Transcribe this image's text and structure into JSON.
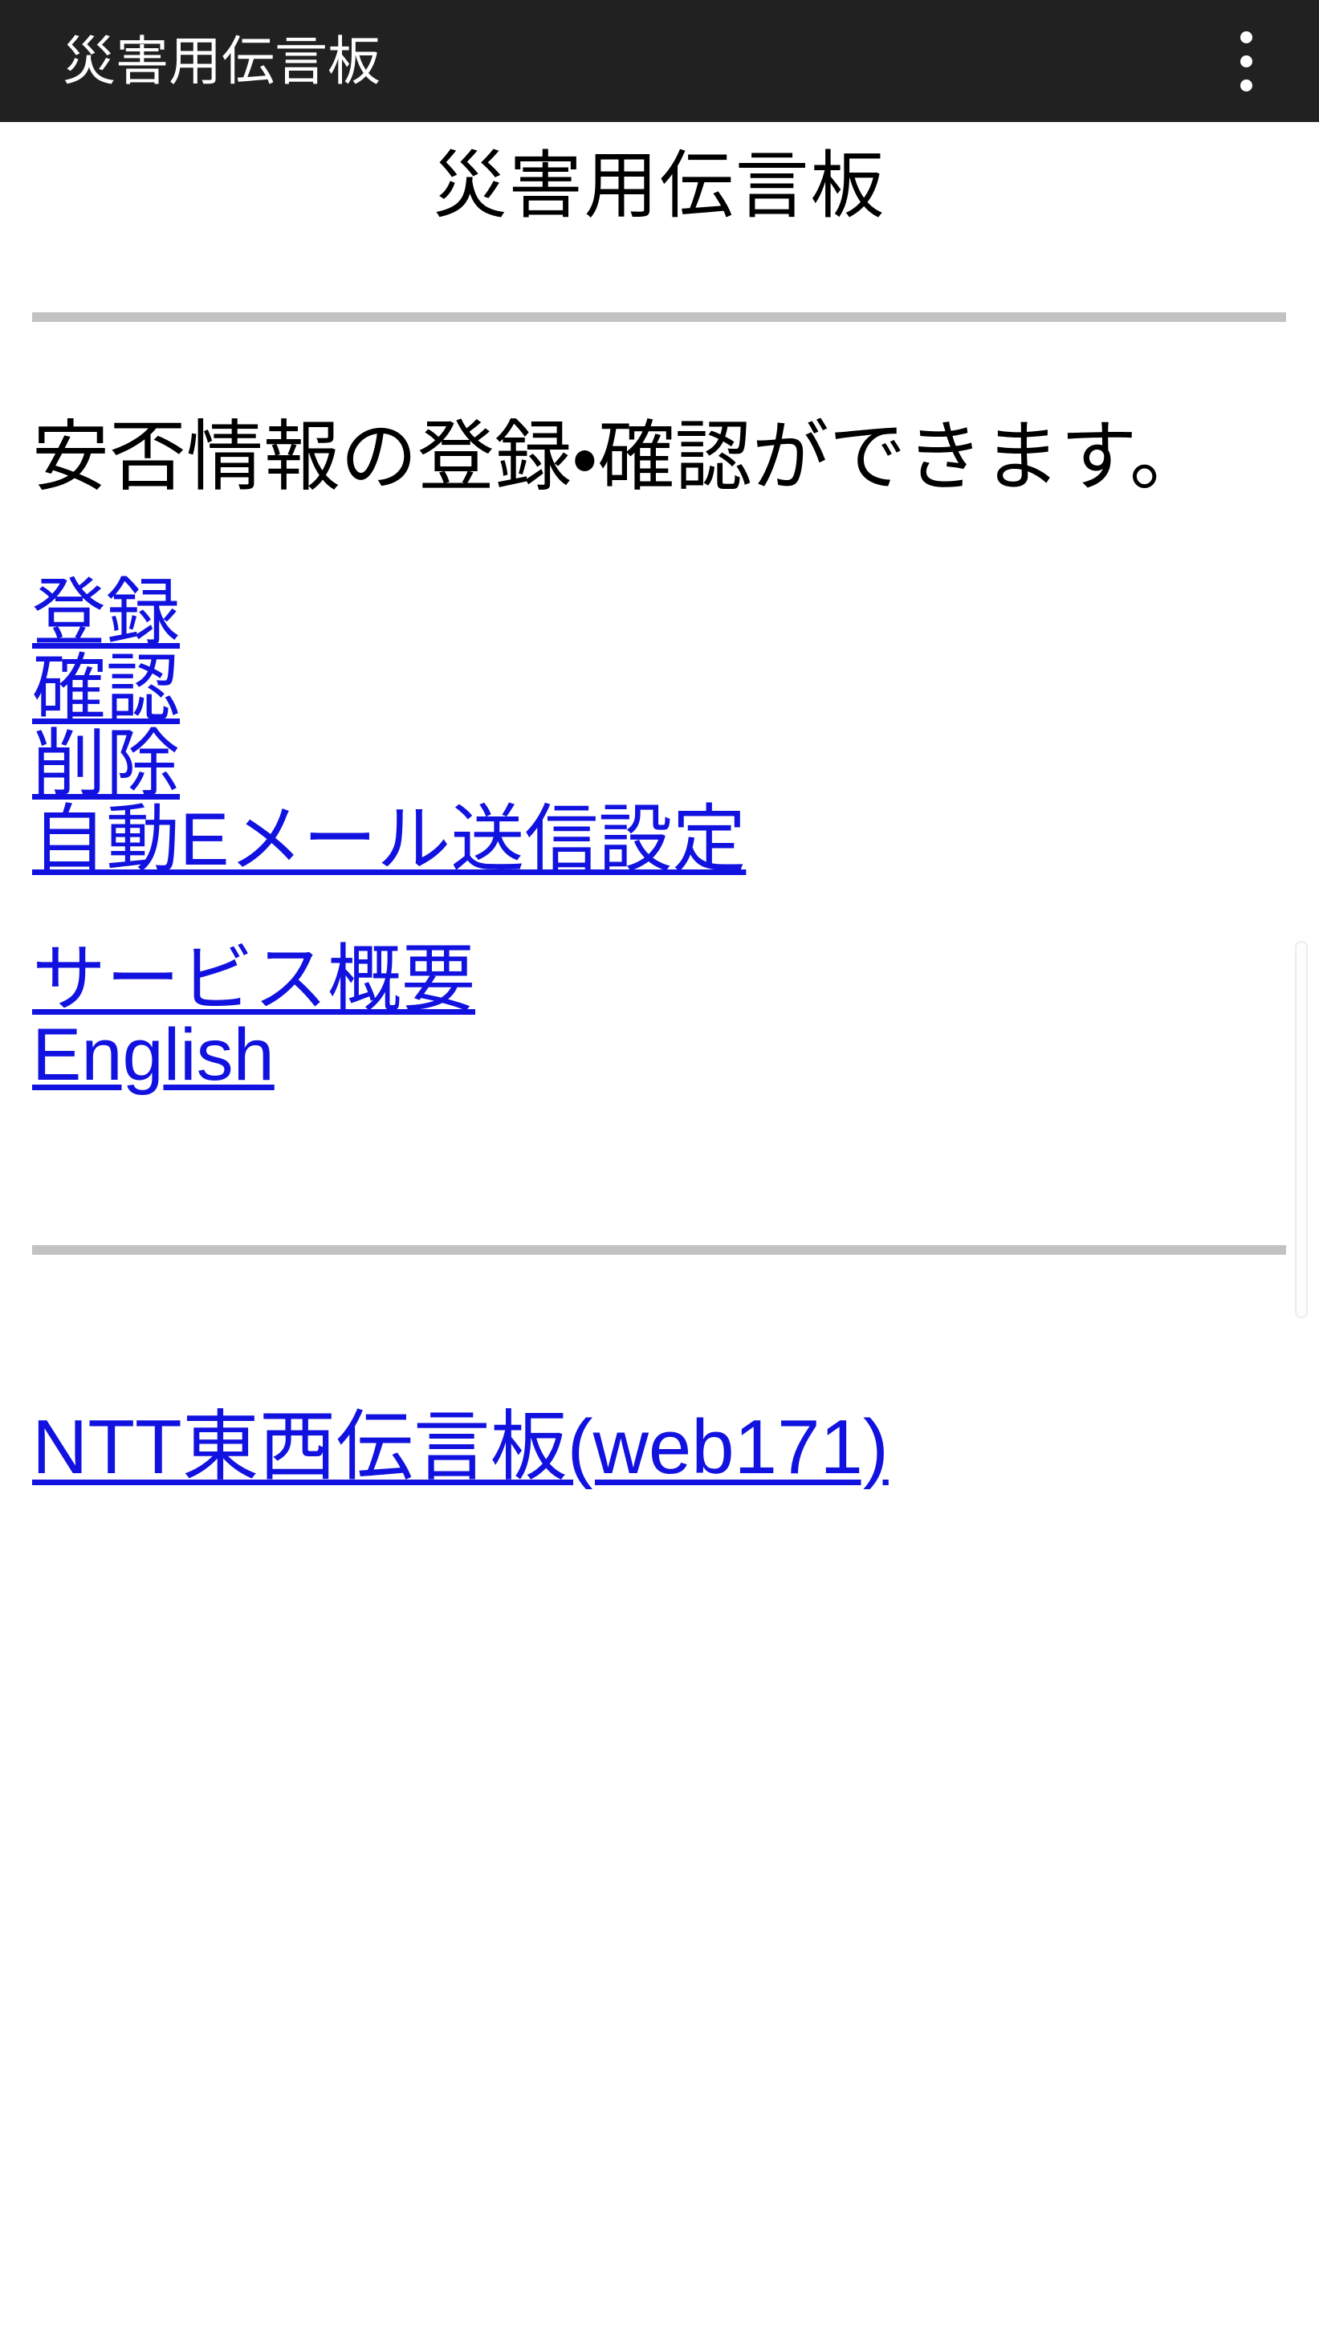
{
  "appbar": {
    "title": "災害用伝言板",
    "overflow_menu_label": "more-options",
    "background_color": "#212121",
    "text_color": "#ffffff"
  },
  "page": {
    "heading": "災害用伝言板",
    "intro_text": "安否情報の登録・確認ができます。",
    "rule_color": "#c2c2c2",
    "link_color": "#1212e0",
    "background_color": "#ffffff"
  },
  "primary_links": [
    {
      "label": "登録"
    },
    {
      "label": "確認"
    },
    {
      "label": "削除"
    },
    {
      "label": "自動Eメール送信設定"
    }
  ],
  "secondary_links": [
    {
      "label": "サービス概要"
    },
    {
      "label": "English"
    }
  ],
  "footer_links": [
    {
      "label": "NTT東西伝言板(web171)"
    }
  ],
  "scrollbar": {
    "orientation": "vertical",
    "thumb_color": "#fdfdfd"
  }
}
